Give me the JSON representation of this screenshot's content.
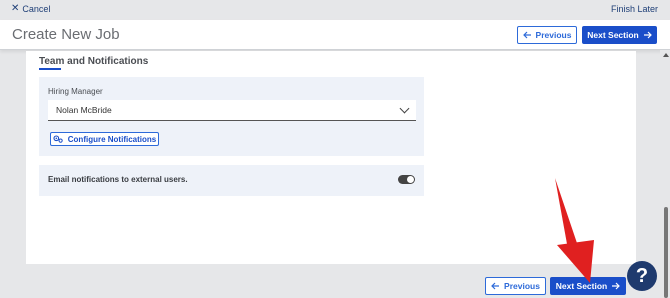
{
  "topbar": {
    "cancel_label": "Cancel",
    "finish_later_label": "Finish Later"
  },
  "header": {
    "title": "Create New Job",
    "previous_label": "Previous",
    "next_label": "Next Section"
  },
  "section": {
    "title": "Team and Notifications",
    "hiring_manager": {
      "label": "Hiring Manager",
      "value": "Nolan McBride"
    },
    "configure_notifications_label": "Configure Notifications",
    "email_toggle": {
      "label": "Email notifications to external users.",
      "enabled": false
    }
  },
  "footer": {
    "previous_label": "Previous",
    "next_label": "Next Section"
  },
  "help": {
    "label": "?"
  },
  "colors": {
    "primary": "#1a4ec9",
    "navy": "#1e3a6e",
    "annotation_arrow": "#e02020"
  }
}
